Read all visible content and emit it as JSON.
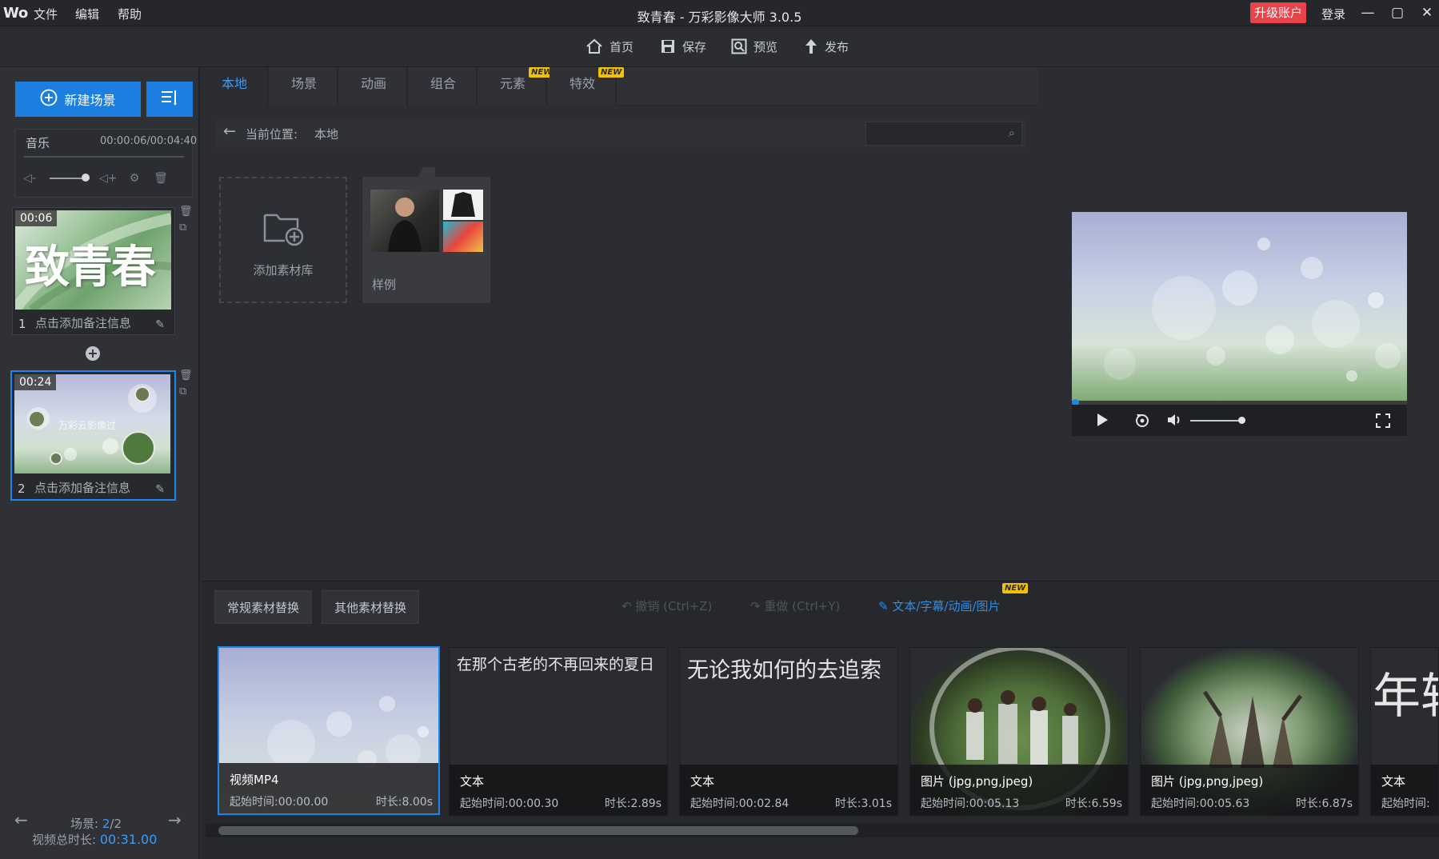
{
  "titlebar": {
    "logo": "Wᴏ",
    "menu": [
      "文件",
      "编辑",
      "帮助"
    ],
    "title": "致青春 - 万彩影像大师 3.0.5",
    "upgrade": "升级账户",
    "login": "登录",
    "min": "—",
    "max": "▢",
    "close": "✕"
  },
  "toolbar": {
    "home": "首页",
    "save": "保存",
    "preview": "预览",
    "publish": "发布"
  },
  "left": {
    "new_scene": "新建场景",
    "music_label": "音乐",
    "music_time": "00:00:06/00:04:40",
    "volume_level": 0.7,
    "scenes": [
      {
        "time": "00:06",
        "num": "1",
        "note": "点击添加备注信息",
        "title_text": "致青春"
      },
      {
        "time": "00:24",
        "num": "2",
        "note": "点击添加备注信息",
        "title_text": "万彩云影像过"
      }
    ],
    "footer": {
      "scene_label": "场景:",
      "scene_current": "2",
      "scene_sep": "/2",
      "total_label": "视频总时长:",
      "total_value": "00:31.00"
    }
  },
  "center": {
    "tabs": [
      {
        "label": "本地",
        "new": false
      },
      {
        "label": "场景",
        "new": false
      },
      {
        "label": "动画",
        "new": false
      },
      {
        "label": "组合",
        "new": false
      },
      {
        "label": "元素",
        "new": true
      },
      {
        "label": "特效",
        "new": true
      }
    ],
    "new_badge": "NEW",
    "path_label": "当前位置:",
    "path_value": "本地",
    "add_library": "添加素材库",
    "sample": "样例"
  },
  "bottom": {
    "tabs": [
      "常规素材替换",
      "其他素材替换"
    ],
    "undo": "撤销 (Ctrl+Z)",
    "redo": "重做 (Ctrl+Y)",
    "text_action": "文本/字幕/动画/图片",
    "new_badge": "NEW",
    "cards": [
      {
        "type": "视频MP4",
        "start": "起始时间:00:00.00",
        "dur": "时长:8.00s",
        "text": ""
      },
      {
        "type": "文本",
        "start": "起始时间:00:00.30",
        "dur": "时长:2.89s",
        "text": "在那个古老的不再回来的夏日"
      },
      {
        "type": "文本",
        "start": "起始时间:00:02.84",
        "dur": "时长:3.01s",
        "text": "无论我如何的去追索"
      },
      {
        "type": "图片 (jpg,png,jpeg)",
        "start": "起始时间:00:05.13",
        "dur": "时长:6.59s",
        "text": ""
      },
      {
        "type": "图片 (jpg,png,jpeg)",
        "start": "起始时间:00:05.63",
        "dur": "时长:6.87s",
        "text": ""
      },
      {
        "type": "文本",
        "start": "起始时间:",
        "dur": "",
        "text": "年轻"
      }
    ]
  },
  "colors": {
    "accent": "#1c7fe0",
    "upgrade": "#e8424b",
    "bg": "#2b2d32"
  }
}
